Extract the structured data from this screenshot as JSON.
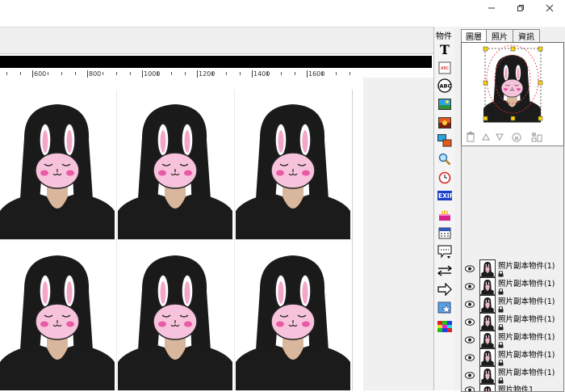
{
  "window": {
    "minimize_icon": "minimize-icon",
    "restore_icon": "restore-icon",
    "close_icon": "close-icon"
  },
  "ruler": {
    "labels": [
      "600",
      "800",
      "1000",
      "1200",
      "1400",
      "1600"
    ]
  },
  "canvas": {
    "photo_count": 6
  },
  "object_toolbar": {
    "title": "物件",
    "tools": [
      "text-tool-icon",
      "abc-frame-icon",
      "abc-circle-icon",
      "landscape-image-icon",
      "sunset-image-icon",
      "photo-stack-icon",
      "magnifier-icon",
      "clock-icon",
      "exif-icon",
      "birthday-cake-icon",
      "calendar-icon",
      "speech-bubble-icon",
      "swap-arrows-icon",
      "arrow-right-icon",
      "star-frame-icon",
      "color-grid-icon"
    ],
    "exif_label": "EXIF"
  },
  "right_panel": {
    "tabs": [
      "圖層",
      "照片",
      "資訊"
    ],
    "active_tab": 0,
    "layer_tools": [
      "trash-icon",
      "up-arrow-icon",
      "down-arrow-icon",
      "lock-icon",
      "align-icon"
    ],
    "layers": [
      {
        "name": "照片副本物件(1)",
        "visible": true
      },
      {
        "name": "照片副本物件(1)",
        "visible": true
      },
      {
        "name": "照片副本物件(1)",
        "visible": true
      },
      {
        "name": "照片副本物件(1)",
        "visible": true
      },
      {
        "name": "照片副本物件(1)",
        "visible": true
      },
      {
        "name": "照片副本物件(1)",
        "visible": true
      },
      {
        "name": "照片副本物件(1)",
        "visible": true
      },
      {
        "name": "照片物件1",
        "visible": true
      }
    ]
  }
}
